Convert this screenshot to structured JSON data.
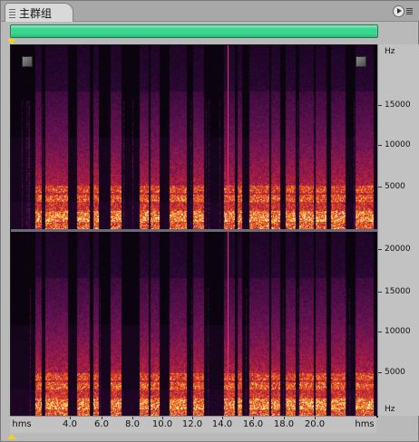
{
  "panel": {
    "tab_label": "主群组",
    "menu_icon": "panel-menu-icon"
  },
  "overview": {
    "color": "#39d68f",
    "visible_fraction": 1.0
  },
  "playhead_color": "#f2d21c",
  "spectrogram": {
    "channels": 2,
    "cursor_color": "#e83a6a",
    "bursts": [
      {
        "start": 0.066,
        "end": 0.082
      },
      {
        "start": 0.092,
        "end": 0.155
      },
      {
        "start": 0.18,
        "end": 0.215
      },
      {
        "start": 0.225,
        "end": 0.24
      },
      {
        "start": 0.272,
        "end": 0.3
      },
      {
        "start": 0.35,
        "end": 0.375
      },
      {
        "start": 0.38,
        "end": 0.405
      },
      {
        "start": 0.432,
        "end": 0.478
      },
      {
        "start": 0.497,
        "end": 0.527
      },
      {
        "start": 0.58,
        "end": 0.61
      },
      {
        "start": 0.617,
        "end": 0.63
      },
      {
        "start": 0.65,
        "end": 0.705
      },
      {
        "start": 0.71,
        "end": 0.735
      },
      {
        "start": 0.75,
        "end": 0.775
      },
      {
        "start": 0.785,
        "end": 0.825
      },
      {
        "start": 0.83,
        "end": 0.86
      },
      {
        "start": 0.873,
        "end": 0.912
      },
      {
        "start": 0.94,
        "end": 0.99
      }
    ]
  },
  "yaxis": {
    "unit": "Hz",
    "ch1_labels": [
      "15000",
      "10000",
      "5000"
    ],
    "ch2_labels": [
      "20000",
      "15000",
      "10000",
      "5000"
    ],
    "ch2_unit": "Hz"
  },
  "xaxis": {
    "left_unit": "hms",
    "right_unit": "hms",
    "ticks": [
      "4.0",
      "6.0",
      "8.0",
      "10.0",
      "12.0",
      "14.0",
      "16.0",
      "18.0",
      "20.0"
    ]
  }
}
